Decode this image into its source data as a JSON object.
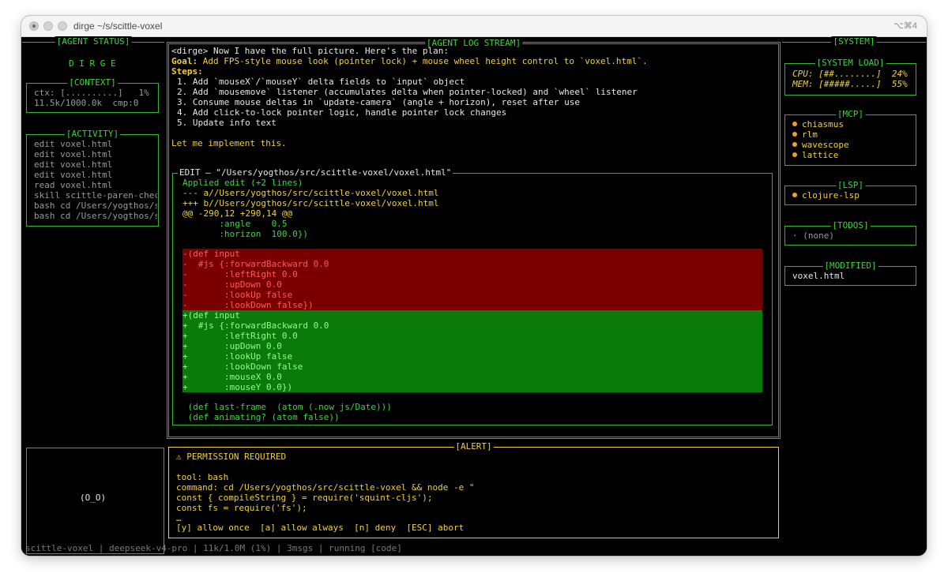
{
  "window": {
    "title": "dirge ~/s/scittle-voxel",
    "shortcut": "⌥⌘4"
  },
  "agent_status": {
    "title": "[AGENT STATUS]",
    "logo": "D I R G E",
    "context": {
      "title": "[CONTEXT]",
      "line1": "ctx: [..........]   1%",
      "line2": "11.5k/1000.0k  cmp:0"
    },
    "activity": {
      "title": "[ACTIVITY]",
      "items": [
        "edit voxel.html",
        "edit voxel.html",
        "edit voxel.html",
        "edit voxel.html",
        "read voxel.html",
        "skill scittle-paren-chec",
        "bash cd /Users/yogthos/s",
        "bash cd /Users/yogthos/s"
      ]
    },
    "face": "(O_O)"
  },
  "log": {
    "title": "[AGENT LOG STREAM]",
    "intro": "<dirge> Now I have the full picture. Here's the plan:",
    "goal_label": "Goal:",
    "goal_text": " Add FPS-style mouse look (pointer lock) + mouse wheel height control to `voxel.html`.",
    "steps_label": "Steps:",
    "steps": [
      "1. Add `mouseX`/`mouseY` delta fields to `input` object",
      "2. Add `mousemove` listener (accumulates delta when pointer-locked) and `wheel` listener",
      "3. Consume mouse deltas in `update-camera` (angle + horizon), reset after use",
      "4. Add click-to-lock pointer logic, handle pointer lock changes",
      "5. Update info text"
    ],
    "outro": "Let me implement this.",
    "edit": {
      "title": " EDIT — \"/Users/yogthos/src/scittle-voxel/voxel.html\"",
      "applied": "Applied edit (+2 lines)",
      "header": [
        "--- a//Users/yogthos/src/scittle-voxel/voxel.html",
        "+++ b//Users/yogthos/src/scittle-voxel/voxel.html",
        "@@ -290,12 +290,14 @@"
      ],
      "context_before": [
        "       :angle    0.5",
        "       :horizon  100.0})"
      ],
      "removed": [
        "-(def input",
        "-  #js {:forwardBackward 0.0",
        "-       :leftRight 0.0",
        "-       :upDown 0.0",
        "-       :lookUp false",
        "-       :lookDown false})"
      ],
      "added": [
        "+(def input",
        "+  #js {:forwardBackward 0.0",
        "+       :leftRight 0.0",
        "+       :upDown 0.0",
        "+       :lookUp false",
        "+       :lookDown false",
        "+       :mouseX 0.0",
        "+       :mouseY 0.0})"
      ],
      "context_after": [
        " (def last-frame  (atom (.now js/Date)))",
        " (def animating? (atom false))"
      ]
    }
  },
  "system": {
    "title": "[SYSTEM]",
    "load": {
      "title": "[SYSTEM LOAD]",
      "cpu": "CPU: [##........]  24%",
      "mem": "MEM: [#####.....]  55%"
    },
    "mcp": {
      "title": "[MCP]",
      "items": [
        "chiasmus",
        "rlm",
        "wavescope",
        "lattice"
      ]
    },
    "lsp": {
      "title": "[LSP]",
      "items": [
        "clojure-lsp"
      ]
    },
    "todos": {
      "title": "[TODOS]",
      "empty": "· (none)"
    },
    "modified": {
      "title": "[MODIFIED]",
      "items": [
        "voxel.html"
      ]
    }
  },
  "alert": {
    "title": "[ALERT]",
    "header": "⚠ PERMISSION REQUIRED",
    "lines": [
      "tool: bash",
      "command: cd /Users/yogthos/src/scittle-voxel && node -e \"",
      "const { compileString } = require('squint-cljs');",
      "const fs = require('fs');",
      "…"
    ],
    "options": "[y] allow once  [a] allow always  [n] deny  [ESC] abort"
  },
  "statusbar": "scittle-voxel | deepseek-v4-pro | 11k/1.0M (1%) | 3msgs | running [code]"
}
